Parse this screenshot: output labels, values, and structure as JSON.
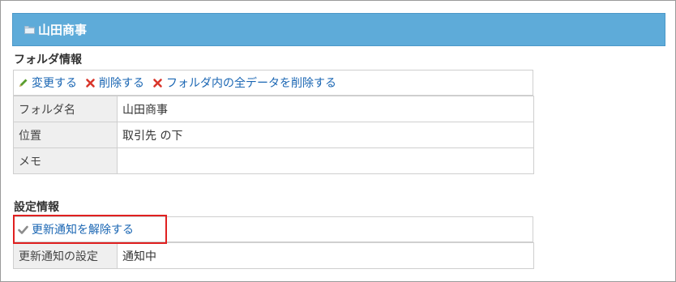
{
  "header": {
    "title": "山田商事",
    "icon": "folder-icon"
  },
  "folder_info": {
    "section_title": "フォルダ情報",
    "actions": [
      {
        "label": "変更する",
        "icon": "pencil-icon"
      },
      {
        "label": "削除する",
        "icon": "delete-x-icon"
      },
      {
        "label": "フォルダ内の全データを削除する",
        "icon": "delete-x-icon"
      }
    ],
    "rows": [
      {
        "label": "フォルダ名",
        "value": "山田商事"
      },
      {
        "label": "位置",
        "value": "取引先 の下"
      },
      {
        "label": "メモ",
        "value": ""
      }
    ]
  },
  "settings_info": {
    "section_title": "設定情報",
    "actions": [
      {
        "label": "更新通知を解除する",
        "icon": "check-icon"
      }
    ],
    "rows": [
      {
        "label": "更新通知の設定",
        "value": "通知中"
      }
    ]
  },
  "colors": {
    "header_bg": "#5eabd9",
    "link": "#1a66b3",
    "delete_icon": "#d9362b",
    "highlight": "#e02020"
  }
}
